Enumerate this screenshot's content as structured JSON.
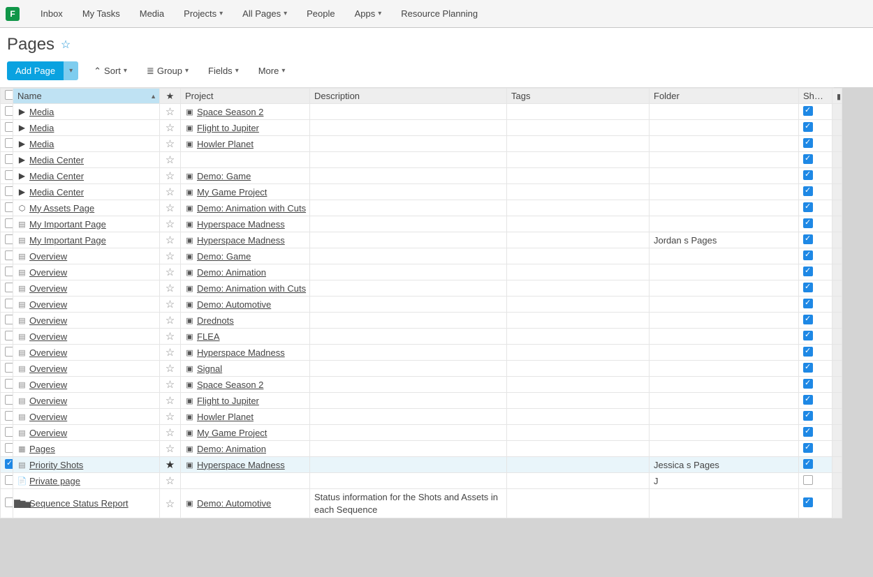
{
  "nav": {
    "brand": "F",
    "items": [
      {
        "label": "Inbox",
        "dropdown": false
      },
      {
        "label": "My Tasks",
        "dropdown": false
      },
      {
        "label": "Media",
        "dropdown": false
      },
      {
        "label": "Projects",
        "dropdown": true
      },
      {
        "label": "All Pages",
        "dropdown": true
      },
      {
        "label": "People",
        "dropdown": false
      },
      {
        "label": "Apps",
        "dropdown": true
      },
      {
        "label": "Resource Planning",
        "dropdown": false
      }
    ]
  },
  "header": {
    "title": "Pages"
  },
  "toolbar": {
    "add_label": "Add Page",
    "sort_label": "Sort",
    "group_label": "Group",
    "fields_label": "Fields",
    "more_label": "More"
  },
  "columns": {
    "name": "Name",
    "star": "★",
    "project": "Project",
    "description": "Description",
    "tags": "Tags",
    "folder": "Folder",
    "shared": "Shared"
  },
  "rows": [
    {
      "icon": "play",
      "name": "Media",
      "starred": false,
      "project": "Space Season 2",
      "description": "",
      "tags": "",
      "folder": "",
      "shared": true,
      "selected": false
    },
    {
      "icon": "play",
      "name": "Media",
      "starred": false,
      "project": "Flight to Jupiter",
      "description": "",
      "tags": "",
      "folder": "",
      "shared": true,
      "selected": false
    },
    {
      "icon": "play",
      "name": "Media",
      "starred": false,
      "project": "Howler Planet",
      "description": "",
      "tags": "",
      "folder": "",
      "shared": true,
      "selected": false
    },
    {
      "icon": "play",
      "name": "Media Center",
      "starred": false,
      "project": "",
      "description": "",
      "tags": "",
      "folder": "",
      "shared": true,
      "selected": false
    },
    {
      "icon": "play",
      "name": "Media Center",
      "starred": false,
      "project": "Demo: Game",
      "description": "",
      "tags": "",
      "folder": "",
      "shared": true,
      "selected": false
    },
    {
      "icon": "play",
      "name": "Media Center",
      "starred": false,
      "project": "My Game Project",
      "description": "",
      "tags": "",
      "folder": "",
      "shared": true,
      "selected": false
    },
    {
      "icon": "asset",
      "name": "My Assets Page",
      "starred": false,
      "project": "Demo: Animation with Cuts",
      "description": "",
      "tags": "",
      "folder": "",
      "shared": true,
      "selected": false
    },
    {
      "icon": "page",
      "name": "My Important Page",
      "starred": false,
      "project": "Hyperspace Madness",
      "description": "",
      "tags": "",
      "folder": "",
      "shared": true,
      "selected": false
    },
    {
      "icon": "page",
      "name": "My Important Page",
      "starred": false,
      "project": "Hyperspace Madness",
      "description": "",
      "tags": "",
      "folder": "Jordan s Pages",
      "shared": true,
      "selected": false
    },
    {
      "icon": "page",
      "name": "Overview",
      "starred": false,
      "project": "Demo: Game",
      "description": "",
      "tags": "",
      "folder": "",
      "shared": true,
      "selected": false
    },
    {
      "icon": "page",
      "name": "Overview",
      "starred": false,
      "project": "Demo: Animation",
      "description": "",
      "tags": "",
      "folder": "",
      "shared": true,
      "selected": false
    },
    {
      "icon": "page",
      "name": "Overview",
      "starred": false,
      "project": "Demo: Animation with Cuts",
      "description": "",
      "tags": "",
      "folder": "",
      "shared": true,
      "selected": false
    },
    {
      "icon": "page",
      "name": "Overview",
      "starred": false,
      "project": "Demo: Automotive",
      "description": "",
      "tags": "",
      "folder": "",
      "shared": true,
      "selected": false
    },
    {
      "icon": "page",
      "name": "Overview",
      "starred": false,
      "project": "Drednots",
      "description": "",
      "tags": "",
      "folder": "",
      "shared": true,
      "selected": false
    },
    {
      "icon": "page",
      "name": "Overview",
      "starred": false,
      "project": "FLEA",
      "description": "",
      "tags": "",
      "folder": "",
      "shared": true,
      "selected": false
    },
    {
      "icon": "page",
      "name": "Overview",
      "starred": false,
      "project": "Hyperspace Madness",
      "description": "",
      "tags": "",
      "folder": "",
      "shared": true,
      "selected": false
    },
    {
      "icon": "page",
      "name": "Overview",
      "starred": false,
      "project": "Signal",
      "description": "",
      "tags": "",
      "folder": "",
      "shared": true,
      "selected": false
    },
    {
      "icon": "page",
      "name": "Overview",
      "starred": false,
      "project": "Space Season 2",
      "description": "",
      "tags": "",
      "folder": "",
      "shared": true,
      "selected": false
    },
    {
      "icon": "page",
      "name": "Overview",
      "starred": false,
      "project": "Flight to Jupiter",
      "description": "",
      "tags": "",
      "folder": "",
      "shared": true,
      "selected": false
    },
    {
      "icon": "page",
      "name": "Overview",
      "starred": false,
      "project": "Howler Planet",
      "description": "",
      "tags": "",
      "folder": "",
      "shared": true,
      "selected": false
    },
    {
      "icon": "page",
      "name": "Overview",
      "starred": false,
      "project": "My Game Project",
      "description": "",
      "tags": "",
      "folder": "",
      "shared": true,
      "selected": false
    },
    {
      "icon": "grid",
      "name": "Pages",
      "starred": false,
      "project": "Demo: Animation",
      "description": "",
      "tags": "",
      "folder": "",
      "shared": true,
      "selected": false
    },
    {
      "icon": "page",
      "name": "Priority Shots",
      "starred": true,
      "project": "Hyperspace Madness",
      "description": "",
      "tags": "",
      "folder": "Jessica s Pages",
      "shared": true,
      "selected": true
    },
    {
      "icon": "doc",
      "name": "Private page",
      "starred": false,
      "project": "",
      "description": "",
      "tags": "",
      "folder": "J",
      "shared": false,
      "selected": false
    },
    {
      "icon": "bars",
      "name": "Sequence Status Report",
      "starred": false,
      "project": "Demo: Automotive",
      "description": "Status information for the Shots and Assets in each Sequence",
      "tags": "",
      "folder": "",
      "shared": true,
      "selected": false
    }
  ]
}
